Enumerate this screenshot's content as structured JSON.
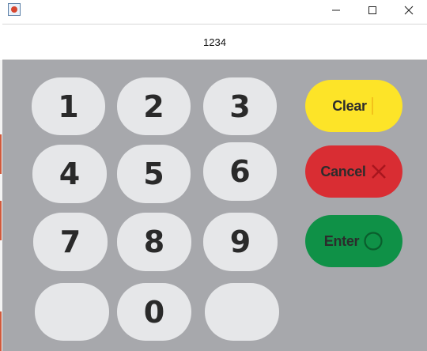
{
  "window": {
    "icon": "java-cup-icon",
    "controls": [
      "minimize-icon",
      "maximize-icon",
      "close-icon"
    ]
  },
  "display": {
    "value": "1234"
  },
  "keypad": {
    "digits": [
      "1",
      "2",
      "3",
      "4",
      "5",
      "6",
      "7",
      "8",
      "9",
      "",
      "0",
      ""
    ]
  },
  "actions": {
    "clear": {
      "label": "Clear",
      "icon": "cursor-bar-icon",
      "color": "#fde428"
    },
    "cancel": {
      "label": "Cancel",
      "icon": "x-icon",
      "color": "#d92d33"
    },
    "enter": {
      "label": "Enter",
      "icon": "circle-icon",
      "color": "#0f9147"
    }
  },
  "colors": {
    "keypad_background": "#a7a8ac",
    "key_face": "#e6e7e9",
    "key_text": "#2a2a2a"
  }
}
